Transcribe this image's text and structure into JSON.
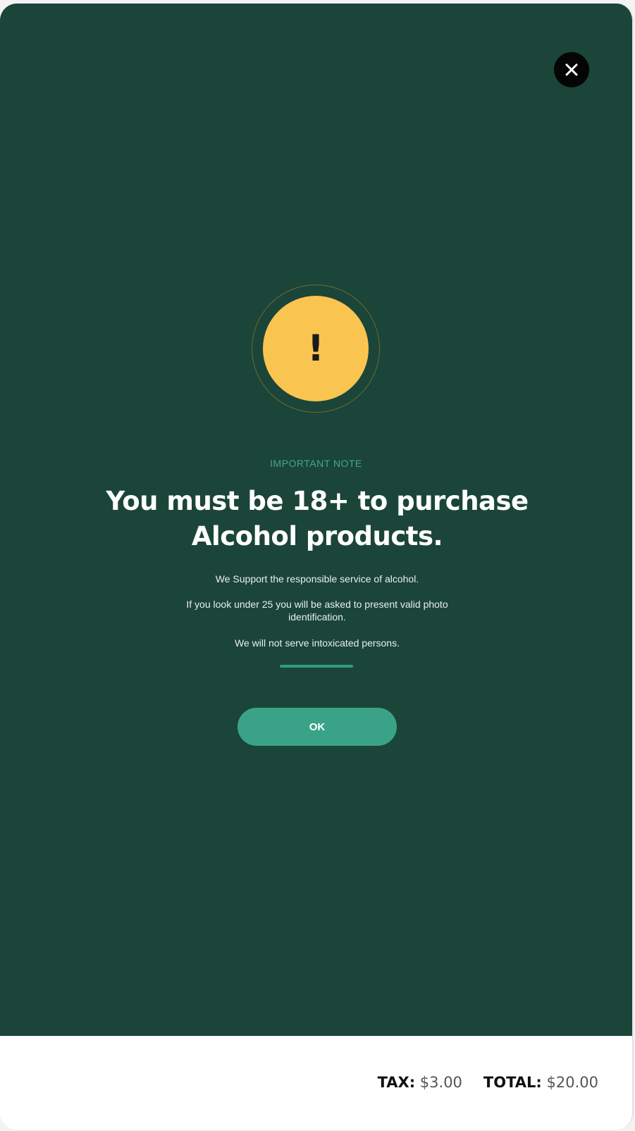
{
  "modal": {
    "eyebrow": "IMPORTANT NOTE",
    "alert_symbol": "!",
    "headline": "You must be 18+ to purchase Alcohol products.",
    "lines": [
      "We Support the responsible service of alcohol.",
      "If you look under 25 you will be asked to present valid photo identification.",
      "We will not serve intoxicated persons."
    ],
    "ok_label": "OK",
    "close_icon": "close-icon",
    "alert_icon": "exclamation-icon"
  },
  "footer": {
    "tax_label": "TAX:",
    "tax_value": "$3.00",
    "total_label": "TOTAL:",
    "total_value": "$20.00"
  },
  "colors": {
    "modal_bg": "#1b4539",
    "accent": "#3aa387",
    "alert": "#f9c44f",
    "eyebrow": "#3fa98a"
  }
}
